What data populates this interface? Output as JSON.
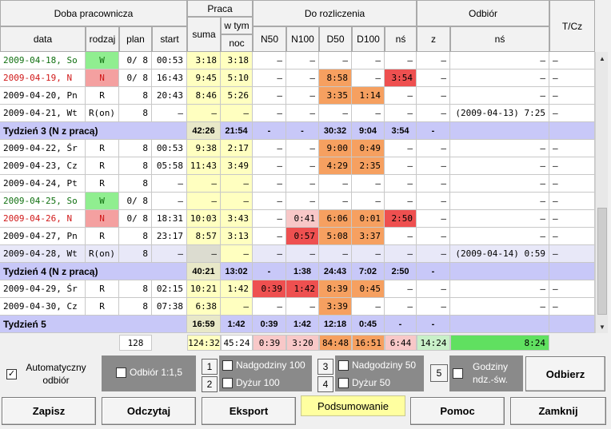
{
  "header": {
    "doba": "Doba pracownicza",
    "praca": "Praca",
    "do_rozliczenia": "Do rozliczenia",
    "odbior": "Odbiór",
    "tcz": "T/Cz",
    "data": "data",
    "rodzaj": "rodzaj",
    "plan": "plan",
    "start": "start",
    "suma": "suma",
    "w_tym": "w tym",
    "noc": "noc",
    "n50": "N50",
    "n100": "N100",
    "d50": "D50",
    "d100": "D100",
    "ns": "nś",
    "z": "z",
    "ns2": "nś"
  },
  "rows": [
    {
      "kind": "day",
      "date": "2009-04-18, So",
      "dcolor": "#107010",
      "rodzaj": "W",
      "rbg": "#90ee90",
      "plan": "0/ 8",
      "start": "00:53",
      "suma": "3:18",
      "noc": "3:18",
      "n50": "–",
      "n100": "–",
      "d50": "–",
      "d100": "–",
      "ns": "–",
      "z": "–",
      "ns2": "–",
      "tcz": "–",
      "bgs": {}
    },
    {
      "kind": "day",
      "date": "2009-04-19, N",
      "dcolor": "#d01818",
      "rodzaj": "N",
      "rbg": "#f4a0a0",
      "plan": "0/ 8",
      "start": "16:43",
      "suma": "9:45",
      "noc": "5:10",
      "n50": "–",
      "n100": "–",
      "d50": "8:58",
      "d100": "–",
      "ns": "3:54",
      "z": "–",
      "ns2": "–",
      "tcz": "–",
      "bgs": {
        "d50": "#f6a060",
        "ns": "#ee5050"
      }
    },
    {
      "kind": "day",
      "date": "2009-04-20, Pn",
      "dcolor": "#000",
      "rodzaj": "R",
      "rbg": "",
      "plan": "8",
      "start": "20:43",
      "suma": "8:46",
      "noc": "5:26",
      "n50": "–",
      "n100": "–",
      "d50": "3:35",
      "d100": "1:14",
      "ns": "–",
      "z": "–",
      "ns2": "–",
      "tcz": "–",
      "bgs": {
        "d50": "#f6a060",
        "d100": "#f6a060"
      }
    },
    {
      "kind": "day",
      "date": "2009-04-21, Wt",
      "dcolor": "#000",
      "rodzaj": "R(on)",
      "rbg": "",
      "plan": "8",
      "start": "–",
      "suma": "–",
      "noc": "–",
      "n50": "–",
      "n100": "–",
      "d50": "–",
      "d100": "–",
      "ns": "–",
      "z": "–",
      "ns2": "(2009-04-13)  7:25",
      "tcz": "–",
      "bgs": {}
    },
    {
      "kind": "week",
      "title": "Tydzień 3 (N z pracą)",
      "suma": "42:26",
      "noc": "21:54",
      "n50": "-",
      "n100": "-",
      "d50": "30:32",
      "d100": "9:04",
      "ns": "3:54",
      "z": "-",
      "ns2": "",
      "tcz": ""
    },
    {
      "kind": "day",
      "date": "2009-04-22, Śr",
      "dcolor": "#000",
      "rodzaj": "R",
      "rbg": "",
      "plan": "8",
      "start": "00:53",
      "suma": "9:38",
      "noc": "2:17",
      "n50": "–",
      "n100": "–",
      "d50": "9:00",
      "d100": "0:49",
      "ns": "–",
      "z": "–",
      "ns2": "–",
      "tcz": "–",
      "bgs": {
        "d50": "#f6a060",
        "d100": "#f6a060"
      }
    },
    {
      "kind": "day",
      "date": "2009-04-23, Cz",
      "dcolor": "#000",
      "rodzaj": "R",
      "rbg": "",
      "plan": "8",
      "start": "05:58",
      "suma": "11:43",
      "noc": "3:49",
      "n50": "–",
      "n100": "–",
      "d50": "4:29",
      "d100": "2:35",
      "ns": "–",
      "z": "–",
      "ns2": "–",
      "tcz": "–",
      "bgs": {
        "d50": "#f6a060",
        "d100": "#f6a060"
      }
    },
    {
      "kind": "day",
      "date": "2009-04-24, Pt",
      "dcolor": "#000",
      "rodzaj": "R",
      "rbg": "",
      "plan": "8",
      "start": "–",
      "suma": "–",
      "noc": "–",
      "n50": "–",
      "n100": "–",
      "d50": "–",
      "d100": "–",
      "ns": "–",
      "z": "–",
      "ns2": "–",
      "tcz": "–",
      "bgs": {}
    },
    {
      "kind": "day",
      "date": "2009-04-25, So",
      "dcolor": "#107010",
      "rodzaj": "W",
      "rbg": "#90ee90",
      "plan": "0/ 8",
      "start": "–",
      "suma": "–",
      "noc": "–",
      "n50": "–",
      "n100": "–",
      "d50": "–",
      "d100": "–",
      "ns": "–",
      "z": "–",
      "ns2": "–",
      "tcz": "–",
      "bgs": {}
    },
    {
      "kind": "day",
      "date": "2009-04-26, N",
      "dcolor": "#d01818",
      "rodzaj": "N",
      "rbg": "#f4a0a0",
      "plan": "0/ 8",
      "start": "18:31",
      "suma": "10:03",
      "noc": "3:43",
      "n50": "–",
      "n100": "0:41",
      "d50": "6:06",
      "d100": "0:01",
      "ns": "2:50",
      "z": "–",
      "ns2": "–",
      "tcz": "–",
      "bgs": {
        "n100": "#f8c8c8",
        "d50": "#f6a060",
        "d100": "#f6a060",
        "ns": "#ee5050"
      }
    },
    {
      "kind": "day",
      "date": "2009-04-27, Pn",
      "dcolor": "#000",
      "rodzaj": "R",
      "rbg": "",
      "plan": "8",
      "start": "23:17",
      "suma": "8:57",
      "noc": "3:13",
      "n50": "–",
      "n100": "0:57",
      "d50": "5:08",
      "d100": "3:37",
      "ns": "–",
      "z": "–",
      "ns2": "–",
      "tcz": "–",
      "bgs": {
        "n100": "#ee5050",
        "d50": "#f6a060",
        "d100": "#f6a060"
      }
    },
    {
      "kind": "day",
      "date": "2009-04-28, Wt",
      "dcolor": "#000",
      "rodzaj": "R(on)",
      "rbg": "",
      "plan": "8",
      "start": "–",
      "suma": "–",
      "noc": "–",
      "n50": "–",
      "n100": "–",
      "d50": "–",
      "d100": "–",
      "ns": "–",
      "z": "–",
      "ns2": "(2009-04-14)  0:59",
      "tcz": "–",
      "bgs": {
        "suma": "#dcdcd0"
      },
      "rowbg": "#e8e8f8"
    },
    {
      "kind": "week",
      "title": "Tydzień 4 (N z pracą)",
      "suma": "40:21",
      "noc": "13:02",
      "n50": "-",
      "n100": "1:38",
      "d50": "24:43",
      "d100": "7:02",
      "ns": "2:50",
      "z": "-",
      "ns2": "",
      "tcz": ""
    },
    {
      "kind": "day",
      "date": "2009-04-29, Śr",
      "dcolor": "#000",
      "rodzaj": "R",
      "rbg": "",
      "plan": "8",
      "start": "02:15",
      "suma": "10:21",
      "noc": "1:42",
      "n50": "0:39",
      "n100": "1:42",
      "d50": "8:39",
      "d100": "0:45",
      "ns": "–",
      "z": "–",
      "ns2": "–",
      "tcz": "–",
      "bgs": {
        "n50": "#ee5050",
        "n100": "#ee5050",
        "d50": "#f6a060",
        "d100": "#f6a060"
      }
    },
    {
      "kind": "day",
      "date": "2009-04-30, Cz",
      "dcolor": "#000",
      "rodzaj": "R",
      "rbg": "",
      "plan": "8",
      "start": "07:38",
      "suma": "6:38",
      "noc": "–",
      "n50": "–",
      "n100": "–",
      "d50": "3:39",
      "d100": "–",
      "ns": "–",
      "z": "–",
      "ns2": "–",
      "tcz": "–",
      "bgs": {
        "d50": "#f6a060"
      }
    },
    {
      "kind": "week",
      "title": "Tydzień 5",
      "suma": "16:59",
      "noc": "1:42",
      "n50": "0:39",
      "n100": "1:42",
      "d50": "12:18",
      "d100": "0:45",
      "ns": "-",
      "z": "-",
      "ns2": "",
      "tcz": ""
    }
  ],
  "totals": {
    "plan": "128",
    "suma": "124:32",
    "noc": "45:24",
    "n50": "0:39",
    "n100": "3:20",
    "d50": "84:48",
    "d100": "16:51",
    "ns": "6:44",
    "z": "14:24",
    "ns2": "8:24"
  },
  "controls": {
    "auto_odbior": "Automatyczny odbiór",
    "odbior_15": "Odbiór 1:1,5",
    "btn1": "1",
    "btn2": "2",
    "btn3": "3",
    "btn4": "4",
    "btn5": "5",
    "nadgodziny100": "Nadgodziny 100",
    "dyzur100": "Dyżur 100",
    "nadgodziny50": "Nadgodziny 50",
    "dyzur50": "Dyżur 50",
    "godziny": "Godziny ndz.-św.",
    "odbierz": "Odbierz"
  },
  "buttons": {
    "zapisz": "Zapisz",
    "odczytaj": "Odczytaj",
    "eksport": "Eksport",
    "podsumowanie": "Podsumowanie",
    "pomoc": "Pomoc",
    "zamknij": "Zamknij"
  },
  "colors": {
    "week_row": "#c8c8f8",
    "suma_col": "#ffffc0",
    "orange": "#f6a060",
    "red": "#ee5050",
    "green": "#60e060",
    "weekday_green": "#107010",
    "sunday_red": "#d01818"
  }
}
